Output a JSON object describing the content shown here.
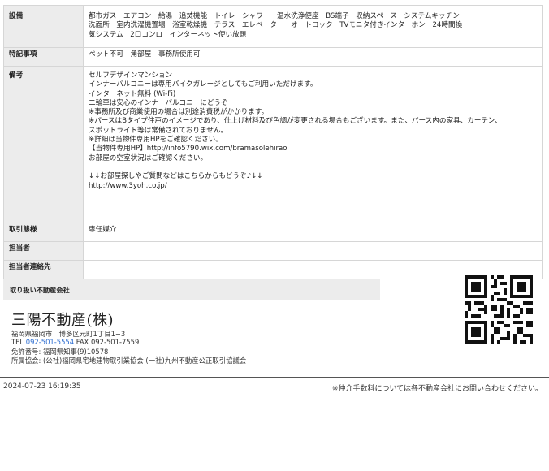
{
  "table": {
    "equipment": {
      "label": "設備",
      "lines": [
        "都市ガス　エアコン　給湯　追焚機能　トイレ　シャワー　温水洗浄便座　BS端子　収納スペース　システムキッチン",
        "洗面所　室内洗濯機置場　浴室乾燥機　テラス　エレベーター　オートロック　TVモニタ付きインターホン　24時間換",
        "気システム　2口コンロ　インターネット使い放題"
      ]
    },
    "special": {
      "label": "特記事項",
      "value": "ペット不可　角部屋　事務所使用可"
    },
    "notes": {
      "label": "備考",
      "lines": [
        "セルフデザインマンション",
        "インナーバルコニーは専用バイクガレージとしてもご利用いただけます。",
        "インターネット無料 (Wi-Fi)",
        "二輪車は安心のインナーバルコニーにどうぞ",
        "※事務所及び商業使用の場合は別途消費税がかかります。",
        "※パースはBタイプ住戸のイメージであり、仕上げ材料及び色調が変更される場合もございます。また、パース内の家具、カーテン、",
        "スポットライト等は常備されておりません。",
        "※詳細は当物件専用HPをご確認ください。",
        "【当物件専用HP】http://info5790.wix.com/bramasolehirao",
        "お部屋の空室状況はご確認ください。",
        " ",
        "↓↓お部屋探しやご質問などはこちらからもどうぞ♪↓↓",
        "http://www.3yoh.co.jp/"
      ]
    },
    "transaction": {
      "label": "取引態様",
      "value": "専任媒介"
    },
    "staff": {
      "label": "担当者",
      "value": ""
    },
    "contact": {
      "label": "担当者連絡先",
      "value": ""
    }
  },
  "agency": {
    "section_title": "取り扱い不動産会社",
    "name": "三陽不動産(株)",
    "address": "福岡県福岡市　博多区元町1丁目1−3",
    "tel_label": "TEL",
    "tel": "092-501-5554",
    "fax_label": "FAX",
    "fax": "092-501-7559",
    "license": "免許番号: 福岡県知事(9)10578",
    "associations": "所属協会: (公社)福岡県宅地建物取引業協会 (一社)九州不動産公正取引協議会"
  },
  "footer": {
    "timestamp": "2024-07-23 16:19:35",
    "disclaimer": "※仲介手数料については各不動産会社にお問い合わせください。"
  }
}
